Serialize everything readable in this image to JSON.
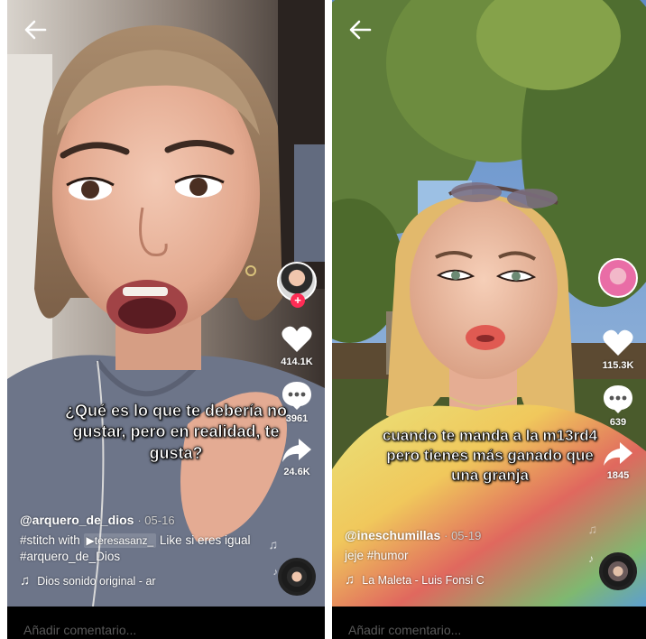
{
  "comment_placeholder": "Añadir comentario...",
  "colors": {
    "like": "#ffffff",
    "follow": "#fe2c55",
    "comment_bar": "#000000"
  },
  "left_video": {
    "caption": "¿Qué es lo que te debería no gustar, pero en realidad, te gusta?",
    "likes": "414.1K",
    "comments": "3961",
    "shares": "24.6K",
    "username": "@arquero_de_dios",
    "date": "· 05-16",
    "desc_prefix": "#stitch with",
    "stitch_user": "▶teresasanz_",
    "desc_suffix": "Like si eres igual #arquero_de_Dios",
    "music": "Dios    sonido original - ar"
  },
  "right_video": {
    "caption": "cuando te manda a la m13rd4 pero tienes más ganado que una granja",
    "likes": "115.3K",
    "comments": "639",
    "shares": "1845",
    "username": "@ineschumillas",
    "date": "· 05-19",
    "description": "jeje #humor",
    "music": "La Maleta - Luis Fonsi   C"
  }
}
